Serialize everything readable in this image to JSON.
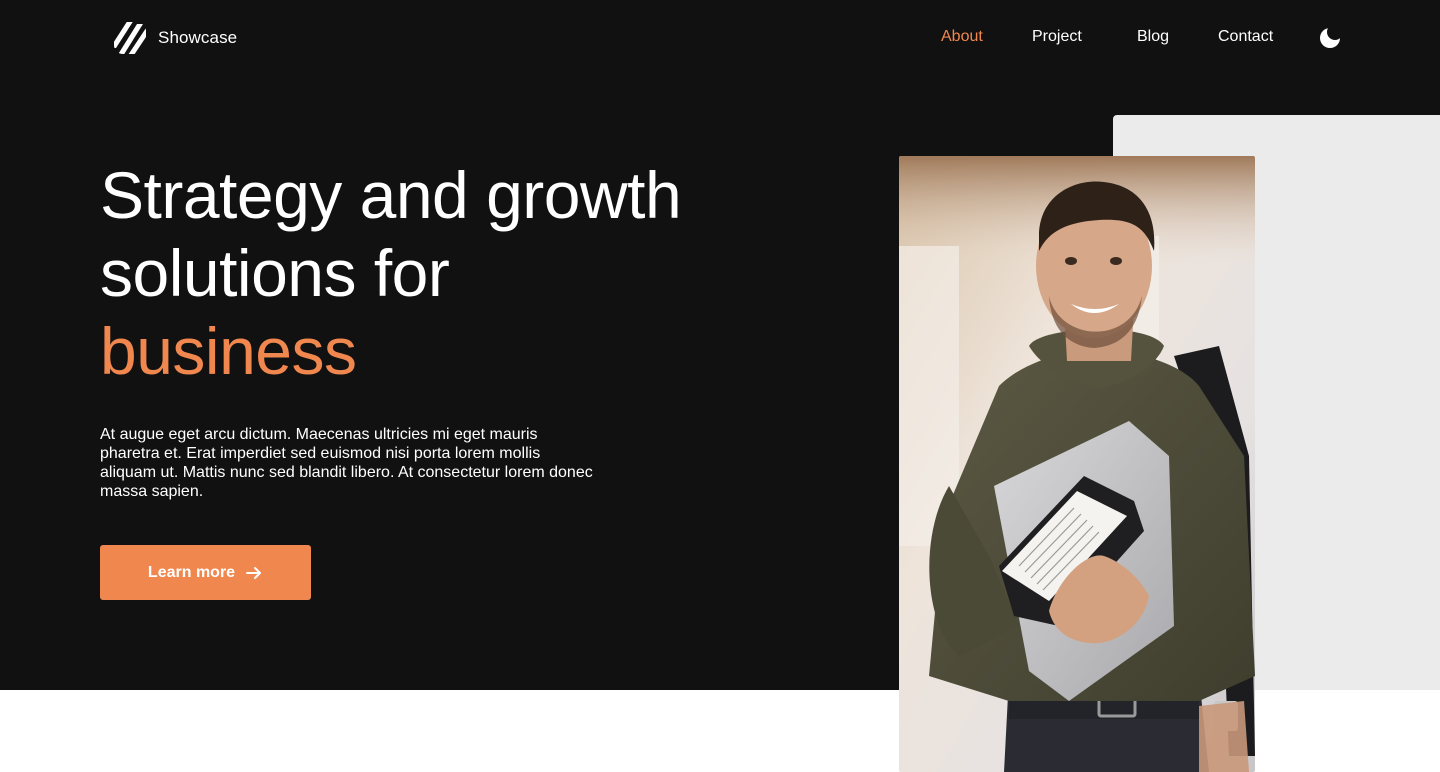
{
  "brand": {
    "name": "Showcase",
    "logo_icon": "stripes-logo-icon"
  },
  "nav": {
    "items": [
      {
        "label": "About",
        "active": true
      },
      {
        "label": "Project",
        "active": false
      },
      {
        "label": "Blog",
        "active": false
      },
      {
        "label": "Contact",
        "active": false
      }
    ],
    "theme_toggle_icon": "moon-icon"
  },
  "hero": {
    "headline_line1": "Strategy and growth",
    "headline_line2": "solutions for",
    "headline_accent": "business",
    "description": "At augue eget arcu dictum. Maecenas ultricies mi eget mauris pharetra et. Erat imperdiet sed euismod nisi porta lorem mollis aliquam ut. Mattis nunc sed blandit libero. At consectetur lorem donec massa sapien.",
    "cta_label": "Learn more",
    "cta_icon": "arrow-right-icon"
  },
  "colors": {
    "accent": "#f0874e",
    "background_dark": "#111111",
    "panel_gray": "#ebebeb",
    "text_light": "#ffffff"
  }
}
